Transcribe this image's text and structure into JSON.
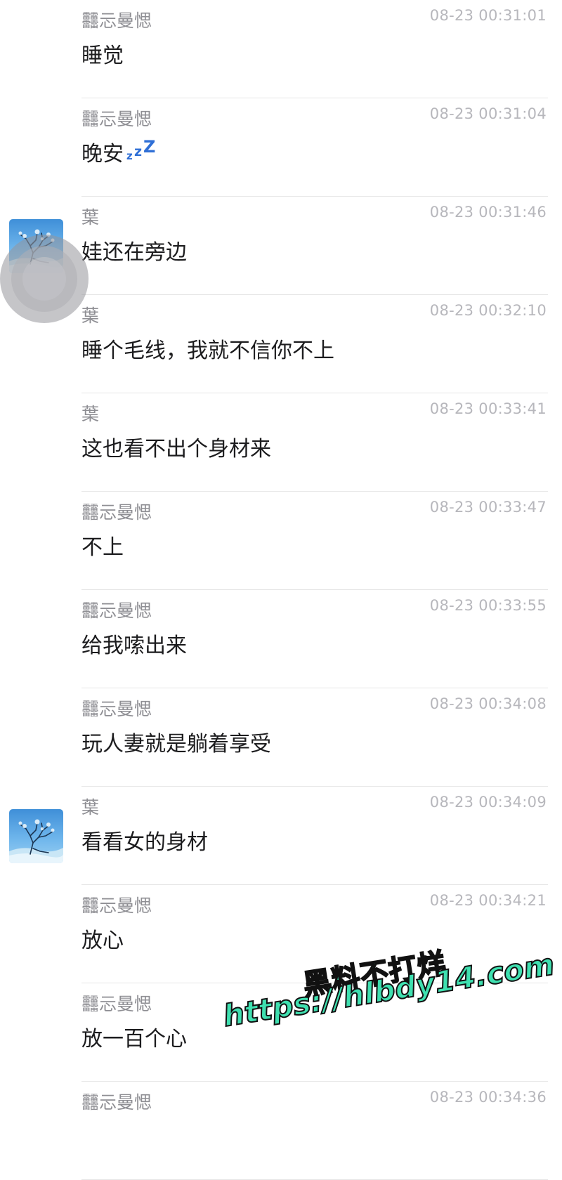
{
  "messages": [
    {
      "sender": "䨻忈曼愢",
      "time": "08-23 00:31:01",
      "text": "睡觉",
      "avatar": false,
      "emoji": ""
    },
    {
      "sender": "䨻忈曼愢",
      "time": "08-23 00:31:04",
      "text": "晚安",
      "avatar": false,
      "emoji": "zzz"
    },
    {
      "sender": "葉",
      "time": "08-23 00:31:46",
      "text": "娃还在旁边",
      "avatar": true,
      "emoji": ""
    },
    {
      "sender": "葉",
      "time": "08-23 00:32:10",
      "text": "睡个毛线，我就不信你不上",
      "avatar": false,
      "emoji": ""
    },
    {
      "sender": "葉",
      "time": "08-23 00:33:41",
      "text": "这也看不出个身材来",
      "avatar": false,
      "emoji": ""
    },
    {
      "sender": "䨻忈曼愢",
      "time": "08-23 00:33:47",
      "text": "不上",
      "avatar": false,
      "emoji": ""
    },
    {
      "sender": "䨻忈曼愢",
      "time": "08-23 00:33:55",
      "text": "给我嗦出来",
      "avatar": false,
      "emoji": ""
    },
    {
      "sender": "䨻忈曼愢",
      "time": "08-23 00:34:08",
      "text": "玩人妻就是躺着享受",
      "avatar": false,
      "emoji": ""
    },
    {
      "sender": "葉",
      "time": "08-23 00:34:09",
      "text": "看看女的身材",
      "avatar": true,
      "emoji": ""
    },
    {
      "sender": "䨻忈曼愢",
      "time": "08-23 00:34:21",
      "text": "放心",
      "avatar": false,
      "emoji": ""
    },
    {
      "sender": "䨻忈曼愢",
      "time": "",
      "text": "放一百个心",
      "avatar": false,
      "emoji": ""
    },
    {
      "sender": "䨻忈曼愢",
      "time": "08-23 00:34:36",
      "text": "",
      "avatar": false,
      "emoji": ""
    }
  ],
  "watermark": {
    "line1": "黑料不打烊",
    "line2": "https://hlbdy14.com"
  },
  "colors": {
    "sender": "#8e8e93",
    "time": "#b7b7bc",
    "text": "#1c1c1e",
    "separator": "#e6e6e6",
    "zzz": "#2f6fd6",
    "watermark": "#3fe0b0"
  },
  "icons": {
    "avatar": "landscape-tree-avatar",
    "emoji": "sleeping-zzz-icon",
    "touch": "touch-indicator"
  }
}
